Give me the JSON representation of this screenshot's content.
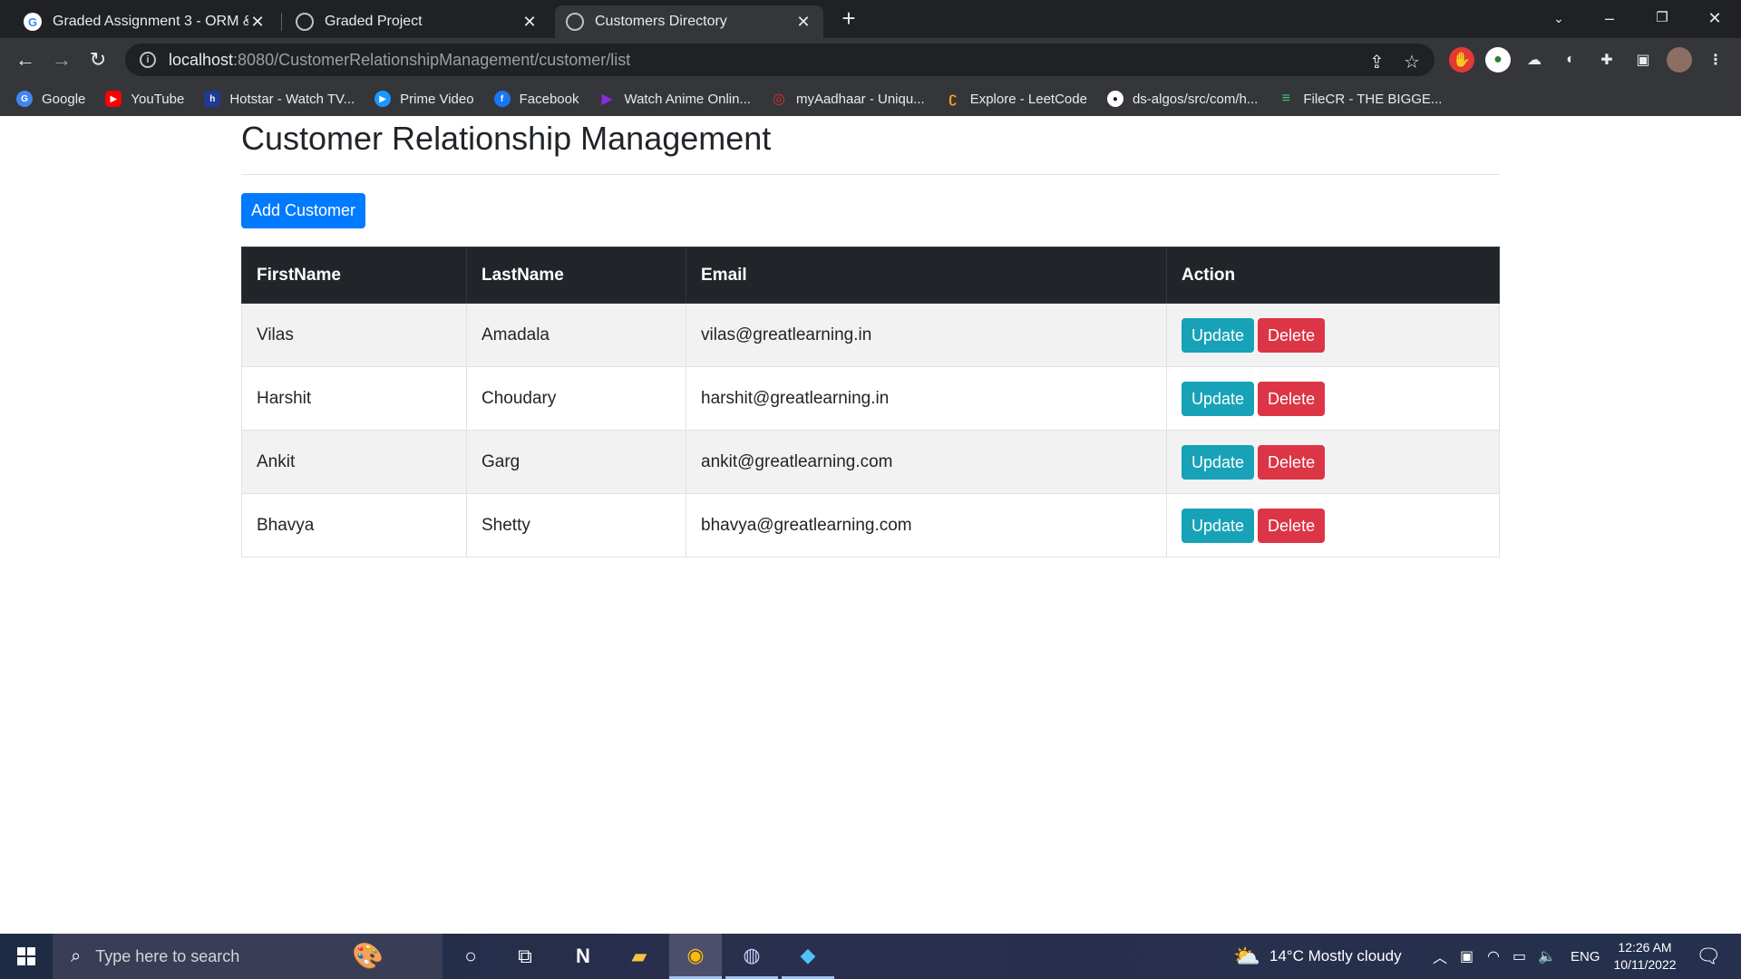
{
  "browser": {
    "tabs": [
      {
        "title": "Graded Assignment 3 - ORM & S",
        "active": false
      },
      {
        "title": "Graded Project",
        "active": false
      },
      {
        "title": "Customers Directory",
        "active": true
      }
    ],
    "url_host": "localhost",
    "url_rest": ":8080/CustomerRelationshipManagement/customer/list",
    "bookmarks": [
      {
        "label": "Google",
        "color": "#4285f4"
      },
      {
        "label": "YouTube",
        "color": "#ff0000"
      },
      {
        "label": "Hotstar - Watch TV...",
        "color": "#1f3a93"
      },
      {
        "label": "Prime Video",
        "color": "#1a98ff"
      },
      {
        "label": "Facebook",
        "color": "#1877f2"
      },
      {
        "label": "Watch Anime Onlin...",
        "color": "#8a2be2"
      },
      {
        "label": "myAadhaar - Uniqu...",
        "color": "#d32f2f"
      },
      {
        "label": "Explore - LeetCode",
        "color": "#ffa116"
      },
      {
        "label": "ds-algos/src/com/h...",
        "color": "#ffffff"
      },
      {
        "label": "FileCR - THE BIGGE...",
        "color": "#2ecc71"
      }
    ]
  },
  "page": {
    "title": "Customer Relationship Management",
    "add_button": "Add Customer",
    "table": {
      "headers": [
        "FirstName",
        "LastName",
        "Email",
        "Action"
      ],
      "rows": [
        {
          "first": "Vilas",
          "last": "Amadala",
          "email": "vilas@greatlearning.in"
        },
        {
          "first": "Harshit",
          "last": "Choudary",
          "email": "harshit@greatlearning.in"
        },
        {
          "first": "Ankit",
          "last": "Garg",
          "email": "ankit@greatlearning.com"
        },
        {
          "first": "Bhavya",
          "last": "Shetty",
          "email": "bhavya@greatlearning.com"
        }
      ],
      "update_label": "Update",
      "delete_label": "Delete"
    }
  },
  "taskbar": {
    "search_placeholder": "Type here to search",
    "weather": "14°C  Mostly cloudy",
    "language": "ENG",
    "time": "12:26 AM",
    "date": "10/11/2022"
  },
  "colors": {
    "primary": "#007bff",
    "info": "#17a2b8",
    "danger": "#dc3545",
    "table_header": "#212529"
  }
}
